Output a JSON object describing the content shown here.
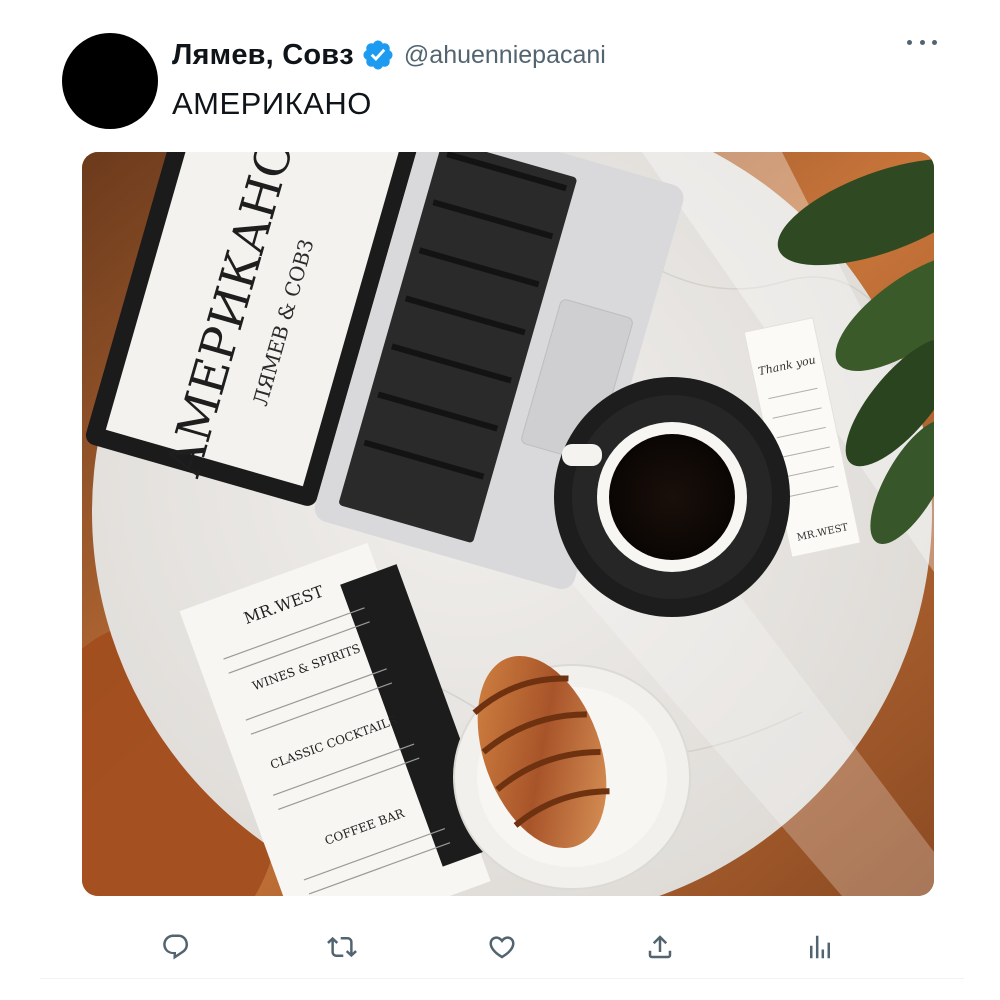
{
  "author": {
    "display_name": "Лямев, Совз",
    "handle": "@ahuenniepacani",
    "avatar_icon": "avatar-circle",
    "verified_icon": "verified-badge-icon"
  },
  "tweet": {
    "text": "АМЕРИКАНО"
  },
  "media": {
    "laptop_title": "АМЕРИКАНО",
    "laptop_subtitle": "ЛЯМЕВ & СОВЗ",
    "menu_brand": "MR.WEST",
    "menu_sections": [
      "WINES & SPIRITS",
      "CLASSIC COCKTAILS",
      "COFFEE BAR"
    ],
    "receipt_note": "Thank you",
    "receipt_brand": "MR.WEST"
  },
  "actions": [
    {
      "icon": "reply-icon"
    },
    {
      "icon": "retweet-icon"
    },
    {
      "icon": "like-icon"
    },
    {
      "icon": "share-icon"
    },
    {
      "icon": "analytics-icon"
    }
  ],
  "colors": {
    "accent": "#1d9bf0",
    "text": "#0f1419",
    "secondary": "#536471"
  }
}
